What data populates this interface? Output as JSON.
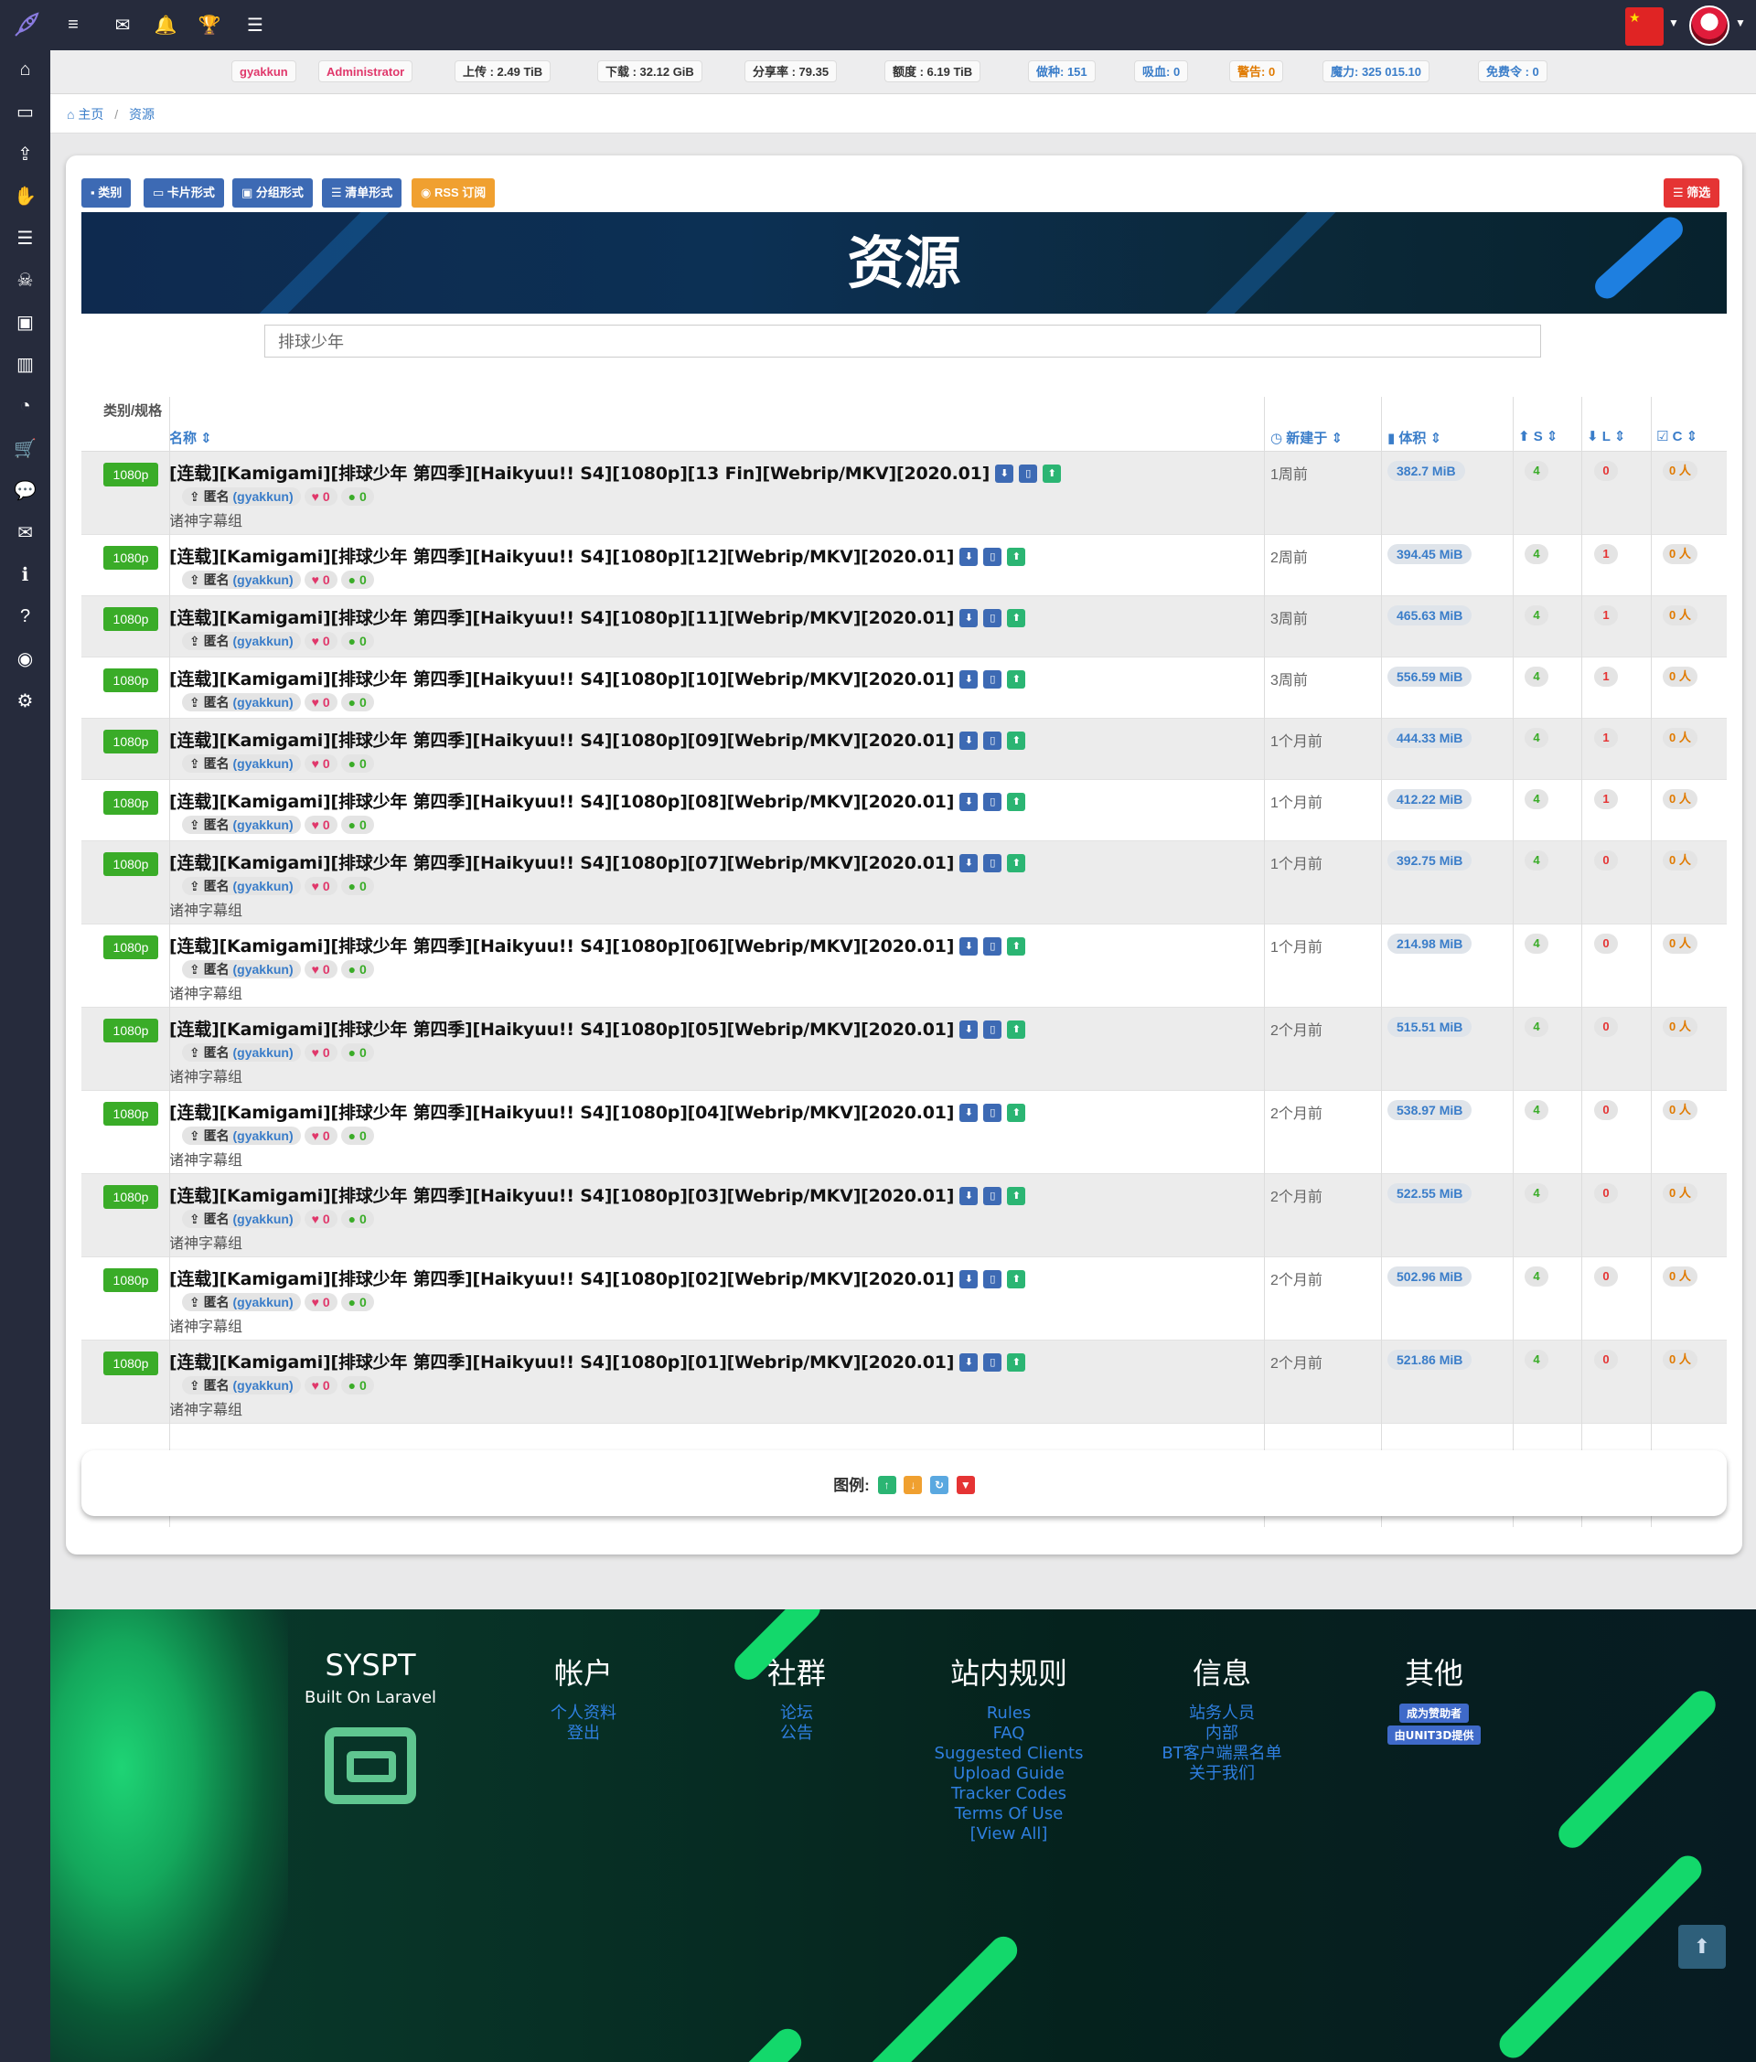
{
  "topbar": {
    "icons": [
      "menu-icon",
      "mail-icon",
      "bell-icon",
      "trophy-icon",
      "tasks-icon"
    ]
  },
  "sidebar": {
    "icons": [
      "home-icon",
      "tv-icon",
      "upload-icon",
      "handshake-icon",
      "list-icon",
      "skull-icon",
      "images-icon",
      "chart-icon",
      "pie-icon",
      "cart-icon",
      "comments-icon",
      "envelope-icon",
      "info-icon",
      "question-icon",
      "rss-icon",
      "cogs-icon"
    ]
  },
  "stats": [
    {
      "label": "gyakkun",
      "color": "#e0386b"
    },
    {
      "label": "Administrator",
      "color": "#e0386b"
    },
    {
      "label": "上传 : 2.49 TiB",
      "color": "#333"
    },
    {
      "label": "下载 : 32.12 GiB",
      "color": "#333"
    },
    {
      "label": "分享率 : 79.35",
      "color": "#333"
    },
    {
      "label": "额度 : 6.19 TiB",
      "color": "#333"
    },
    {
      "label": "做种: 151",
      "color": "#3a7dc9"
    },
    {
      "label": "吸血: 0",
      "color": "#3a7dc9"
    },
    {
      "label": "警告: 0",
      "color": "#e07a00"
    },
    {
      "label": "魔力: 325 015.10",
      "color": "#3a7dc9"
    },
    {
      "label": "免费令 : 0",
      "color": "#3a7dc9"
    }
  ],
  "breadcrumb": {
    "home": "主页",
    "current": "资源"
  },
  "toolbar": {
    "category": "类别",
    "card": "卡片形式",
    "group": "分组形式",
    "list": "清单形式",
    "rss": "RSS 订阅",
    "filter": "筛选"
  },
  "hero": {
    "title": "资源"
  },
  "search": {
    "value": "排球少年"
  },
  "table": {
    "headers": {
      "category": "类别/规格",
      "name": "名称",
      "created": "新建于",
      "size": "体积",
      "seed": "S",
      "leech": "L",
      "complete": "C"
    },
    "rows": [
      {
        "badge": "1080p",
        "title": "[连载][Kamigami][排球少年 第四季][Haikyuu!! S4][1080p][13 Fin][Webrip/MKV][2020.01]",
        "uploader": "匿名",
        "user": "(gyakkun)",
        "likes": "0",
        "comments": "0",
        "group": "诸神字幕组",
        "age": "1周前",
        "size": "382.7 MiB",
        "s": "4",
        "l": "0",
        "c": "0 人"
      },
      {
        "badge": "1080p",
        "title": "[连载][Kamigami][排球少年 第四季][Haikyuu!! S4][1080p][12][Webrip/MKV][2020.01]",
        "uploader": "匿名",
        "user": "(gyakkun)",
        "likes": "0",
        "comments": "0",
        "group": "",
        "age": "2周前",
        "size": "394.45 MiB",
        "s": "4",
        "l": "1",
        "c": "0 人"
      },
      {
        "badge": "1080p",
        "title": "[连载][Kamigami][排球少年 第四季][Haikyuu!! S4][1080p][11][Webrip/MKV][2020.01]",
        "uploader": "匿名",
        "user": "(gyakkun)",
        "likes": "0",
        "comments": "0",
        "group": "",
        "age": "3周前",
        "size": "465.63 MiB",
        "s": "4",
        "l": "1",
        "c": "0 人"
      },
      {
        "badge": "1080p",
        "title": "[连载][Kamigami][排球少年 第四季][Haikyuu!! S4][1080p][10][Webrip/MKV][2020.01]",
        "uploader": "匿名",
        "user": "(gyakkun)",
        "likes": "0",
        "comments": "0",
        "group": "",
        "age": "3周前",
        "size": "556.59 MiB",
        "s": "4",
        "l": "1",
        "c": "0 人"
      },
      {
        "badge": "1080p",
        "title": "[连载][Kamigami][排球少年 第四季][Haikyuu!! S4][1080p][09][Webrip/MKV][2020.01]",
        "uploader": "匿名",
        "user": "(gyakkun)",
        "likes": "0",
        "comments": "0",
        "group": "",
        "age": "1个月前",
        "size": "444.33 MiB",
        "s": "4",
        "l": "1",
        "c": "0 人"
      },
      {
        "badge": "1080p",
        "title": "[连载][Kamigami][排球少年 第四季][Haikyuu!! S4][1080p][08][Webrip/MKV][2020.01]",
        "uploader": "匿名",
        "user": "(gyakkun)",
        "likes": "0",
        "comments": "0",
        "group": "",
        "age": "1个月前",
        "size": "412.22 MiB",
        "s": "4",
        "l": "1",
        "c": "0 人"
      },
      {
        "badge": "1080p",
        "title": "[连载][Kamigami][排球少年 第四季][Haikyuu!! S4][1080p][07][Webrip/MKV][2020.01]",
        "uploader": "匿名",
        "user": "(gyakkun)",
        "likes": "0",
        "comments": "0",
        "group": "诸神字幕组",
        "age": "1个月前",
        "size": "392.75 MiB",
        "s": "4",
        "l": "0",
        "c": "0 人"
      },
      {
        "badge": "1080p",
        "title": "[连载][Kamigami][排球少年 第四季][Haikyuu!! S4][1080p][06][Webrip/MKV][2020.01]",
        "uploader": "匿名",
        "user": "(gyakkun)",
        "likes": "0",
        "comments": "0",
        "group": "诸神字幕组",
        "age": "1个月前",
        "size": "214.98 MiB",
        "s": "4",
        "l": "0",
        "c": "0 人"
      },
      {
        "badge": "1080p",
        "title": "[连载][Kamigami][排球少年 第四季][Haikyuu!! S4][1080p][05][Webrip/MKV][2020.01]",
        "uploader": "匿名",
        "user": "(gyakkun)",
        "likes": "0",
        "comments": "0",
        "group": "诸神字幕组",
        "age": "2个月前",
        "size": "515.51 MiB",
        "s": "4",
        "l": "0",
        "c": "0 人"
      },
      {
        "badge": "1080p",
        "title": "[连载][Kamigami][排球少年 第四季][Haikyuu!! S4][1080p][04][Webrip/MKV][2020.01]",
        "uploader": "匿名",
        "user": "(gyakkun)",
        "likes": "0",
        "comments": "0",
        "group": "诸神字幕组",
        "age": "2个月前",
        "size": "538.97 MiB",
        "s": "4",
        "l": "0",
        "c": "0 人"
      },
      {
        "badge": "1080p",
        "title": "[连载][Kamigami][排球少年 第四季][Haikyuu!! S4][1080p][03][Webrip/MKV][2020.01]",
        "uploader": "匿名",
        "user": "(gyakkun)",
        "likes": "0",
        "comments": "0",
        "group": "诸神字幕组",
        "age": "2个月前",
        "size": "522.55 MiB",
        "s": "4",
        "l": "0",
        "c": "0 人"
      },
      {
        "badge": "1080p",
        "title": "[连载][Kamigami][排球少年 第四季][Haikyuu!! S4][1080p][02][Webrip/MKV][2020.01]",
        "uploader": "匿名",
        "user": "(gyakkun)",
        "likes": "0",
        "comments": "0",
        "group": "诸神字幕组",
        "age": "2个月前",
        "size": "502.96 MiB",
        "s": "4",
        "l": "0",
        "c": "0 人"
      },
      {
        "badge": "1080p",
        "title": "[连载][Kamigami][排球少年 第四季][Haikyuu!! S4][1080p][01][Webrip/MKV][2020.01]",
        "uploader": "匿名",
        "user": "(gyakkun)",
        "likes": "0",
        "comments": "0",
        "group": "诸神字幕组",
        "age": "2个月前",
        "size": "521.86 MiB",
        "s": "4",
        "l": "0",
        "c": "0 人"
      }
    ]
  },
  "legend": {
    "label": "图例:"
  },
  "footer": {
    "brand": "SYSPT",
    "tagline": "Built On Laravel",
    "cols": [
      {
        "title": "帐户",
        "links": [
          "个人资料",
          "登出"
        ]
      },
      {
        "title": "社群",
        "links": [
          "论坛",
          "公告"
        ]
      },
      {
        "title": "站内规则",
        "links": [
          "Rules",
          "FAQ",
          "Suggested Clients",
          "Upload Guide",
          "Tracker Codes",
          "Terms Of Use",
          "[View All]"
        ]
      },
      {
        "title": "信息",
        "links": [
          "站务人员",
          "内部",
          "BT客户端黑名单",
          "关于我们"
        ]
      },
      {
        "title": "其他",
        "tags": [
          "成为赞助者",
          "由UNIT3D提供"
        ]
      }
    ]
  },
  "colors": {
    "nav": "#262b3c",
    "accent": "#3a7dc9",
    "badge": "#3aac28",
    "footer_green": "#13d86b"
  }
}
